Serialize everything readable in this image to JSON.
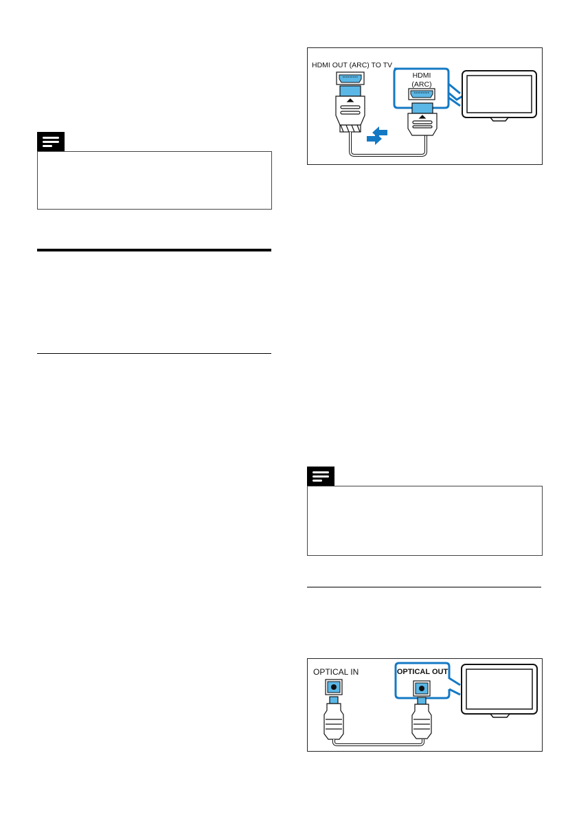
{
  "diagrams": {
    "hdmi": {
      "source_label": "HDMI OUT (ARC) TO TV",
      "tv_port_label_line1": "HDMI",
      "tv_port_label_line2": "(ARC)"
    },
    "optical": {
      "source_label": "OPTICAL IN",
      "tv_port_label": "OPTICAL OUT"
    }
  },
  "colors": {
    "accent_blue": "#1479c4",
    "port_blue": "#5bb7e6",
    "frame": "#222222"
  },
  "icons": {
    "note": "note-lines-icon",
    "tv": "tv-icon",
    "arrows": "bidirectional-arrows-icon"
  }
}
